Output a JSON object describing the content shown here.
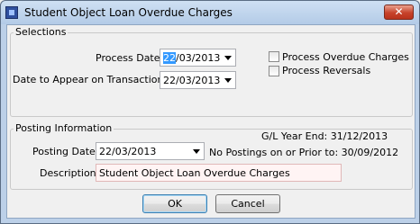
{
  "window": {
    "title": "Student Object Loan Overdue Charges",
    "close_glyph": "✕"
  },
  "selections": {
    "group_label": "Selections",
    "process_date_label": "Process Date:",
    "process_date_value_sel": "22",
    "process_date_value_rest": "/03/2013",
    "appear_date_label": "Date to Appear on Transactions:",
    "appear_date_value": "22/03/2013",
    "process_overdue_label": "Process Overdue Charges",
    "process_reversals_label": "Process Reversals"
  },
  "posting": {
    "group_label": "Posting Information",
    "gl_year_end": "G/L Year End: 31/12/2013",
    "posting_date_label": "Posting Date:",
    "posting_date_value": "22/03/2013",
    "no_postings_text": "No Postings on or Prior to: 30/09/2012",
    "description_label": "Description:",
    "description_value": "Student Object Loan Overdue Charges"
  },
  "buttons": {
    "ok_label": "OK",
    "cancel_label": "Cancel"
  }
}
